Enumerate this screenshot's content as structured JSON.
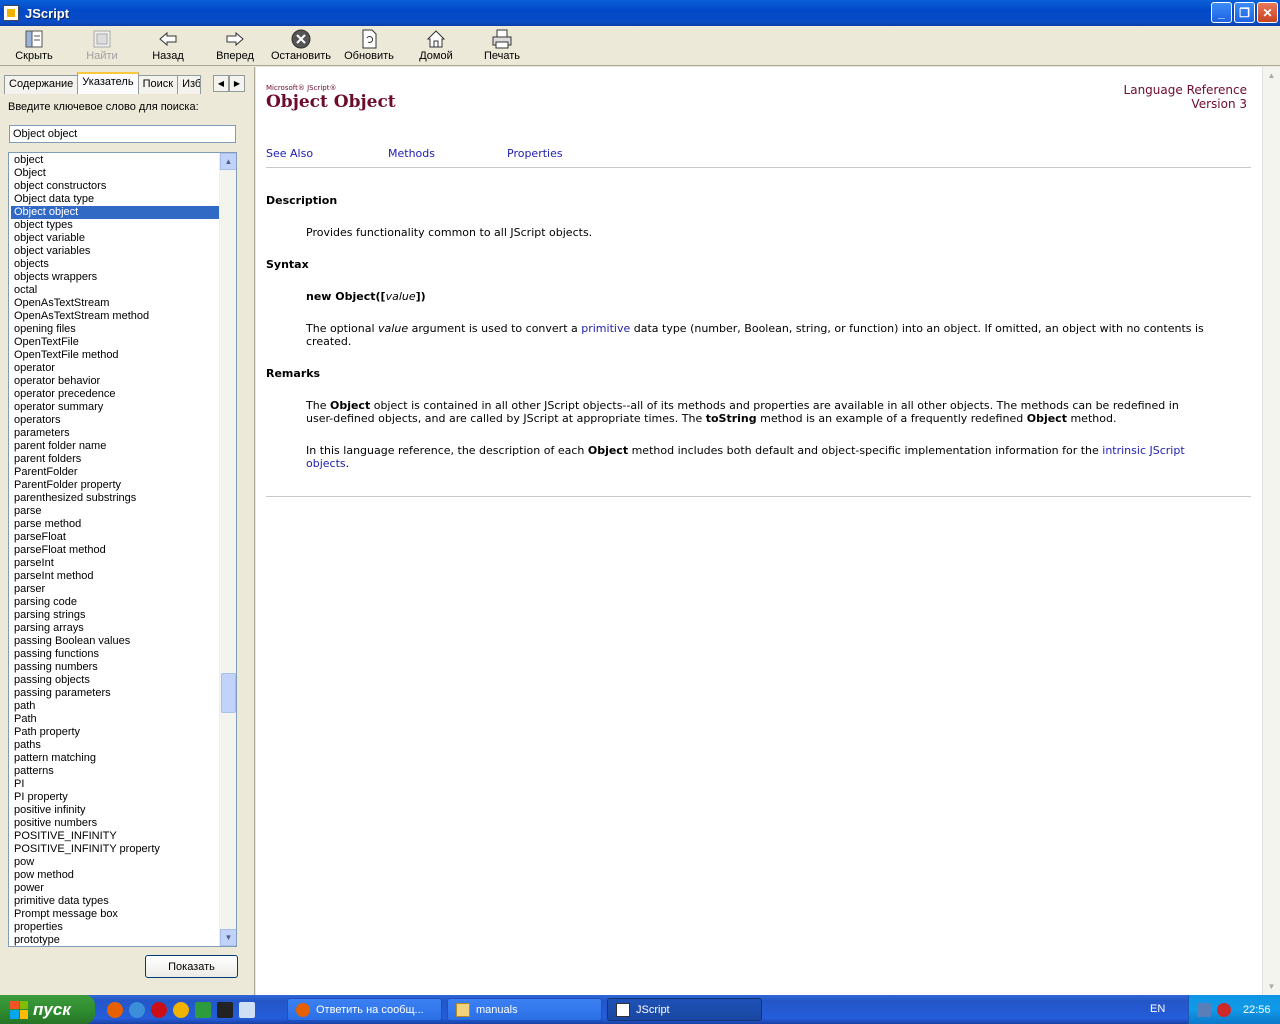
{
  "window": {
    "title": "JScript"
  },
  "toolbar": {
    "hide": "Скрыть",
    "find": "Найти",
    "back": "Назад",
    "forward": "Вперед",
    "stop": "Остановить",
    "refresh": "Обновить",
    "home": "Домой",
    "print": "Печать"
  },
  "tabs": {
    "contents": "Содержание",
    "index": "Указатель",
    "search": "Поиск",
    "favorites": "Изб"
  },
  "index_panel": {
    "prompt": "Введите ключевое слово для поиска:",
    "keyword": "Object object",
    "show_button": "Показать",
    "selected_index": 4,
    "items": [
      "object",
      "Object",
      "object constructors",
      "Object data type",
      "Object object",
      "object types",
      "object variable",
      "object variables",
      "objects",
      "objects wrappers",
      "octal",
      "OpenAsTextStream",
      "OpenAsTextStream method",
      "opening files",
      "OpenTextFile",
      "OpenTextFile method",
      "operator",
      "operator behavior",
      "operator precedence",
      "operator summary",
      "operators",
      "parameters",
      "parent folder name",
      "parent folders",
      "ParentFolder",
      "ParentFolder property",
      "parenthesized substrings",
      "parse",
      "parse method",
      "parseFloat",
      "parseFloat method",
      "parseInt",
      "parseInt method",
      "parser",
      "parsing code",
      "parsing strings",
      "parsing arrays",
      "passing Boolean values",
      "passing functions",
      "passing numbers",
      "passing objects",
      "passing parameters",
      "path",
      "Path",
      "Path property",
      "paths",
      "pattern matching",
      "patterns",
      "PI",
      "PI property",
      "positive infinity",
      "positive numbers",
      "POSITIVE_INFINITY",
      "POSITIVE_INFINITY property",
      "pow",
      "pow method",
      "power",
      "primitive data types",
      "Prompt message box",
      "properties",
      "prototype"
    ]
  },
  "doc": {
    "brand": "Microsoft® JScript®",
    "title": "Object Object",
    "lang_ref": "Language Reference",
    "version": "Version 3",
    "links": {
      "see_also": "See Also",
      "methods": "Methods",
      "properties": "Properties"
    },
    "description_heading": "Description",
    "description_text": "Provides functionality common to all JScript objects.",
    "syntax_heading": "Syntax",
    "syntax_new": "new Object([",
    "syntax_param": "value",
    "syntax_close": "])",
    "syntax_p1": "The optional ",
    "syntax_p1_value": "value",
    "syntax_p1_mid": " argument is used to convert a ",
    "syntax_p1_link": "primitive",
    "syntax_p1_end": " data type (number, Boolean, string, or function) into an object. If omitted, an object with no contents is created.",
    "remarks_heading": "Remarks",
    "remarks_p1_a": "The ",
    "remarks_p1_b": "Object",
    "remarks_p1_c": " object is contained in all other JScript objects--all of its methods and properties are available in all other objects. The methods can be redefined in user-defined objects, and are called by JScript at appropriate times. The ",
    "remarks_p1_d": "toString",
    "remarks_p1_e": " method is an example of a frequently redefined ",
    "remarks_p1_f": "Object",
    "remarks_p1_g": " method.",
    "remarks_p2_a": "In this language reference, the description of each ",
    "remarks_p2_b": "Object",
    "remarks_p2_c": " method includes both default and object-specific implementation information for the ",
    "remarks_p2_link": "intrinsic JScript objects",
    "remarks_p2_end": "."
  },
  "taskbar": {
    "start": "пуск",
    "tasks": [
      "Ответить на сообщ...",
      "manuals",
      "JScript"
    ],
    "lang": "EN",
    "clock": "22:56"
  }
}
